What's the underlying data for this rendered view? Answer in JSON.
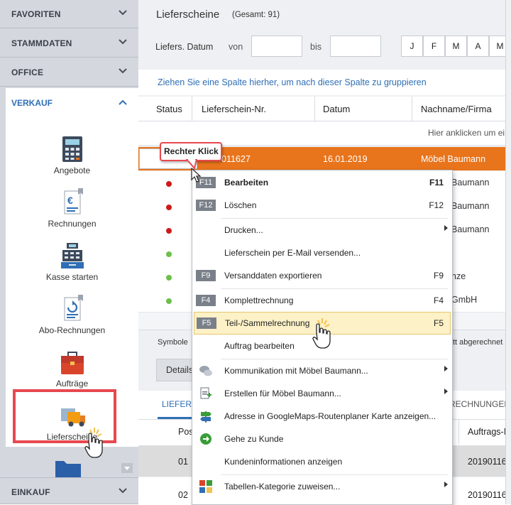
{
  "sidebar": {
    "sections": {
      "favoriten": "FAVORITEN",
      "stammdaten": "STAMMDATEN",
      "office": "OFFICE",
      "verkauf": "VERKAUF",
      "einkauf": "EINKAUF"
    },
    "items": [
      {
        "label": "Angebote",
        "icon": "calculator-icon"
      },
      {
        "label": "Rechnungen",
        "icon": "invoice-euro-icon"
      },
      {
        "label": "Kasse starten",
        "icon": "cash-register-icon"
      },
      {
        "label": "Abo-Rechnungen",
        "icon": "subscription-invoice-icon"
      },
      {
        "label": "Aufträge",
        "icon": "briefcase-icon"
      },
      {
        "label": "Lieferscheine",
        "icon": "delivery-truck-icon"
      }
    ]
  },
  "header": {
    "title": "Lieferscheine",
    "count": "(Gesamt: 91)",
    "date_label": "Liefers. Datum",
    "from_label": "von",
    "to_label": "bis",
    "month_buttons": [
      "J",
      "F",
      "M",
      "A",
      "M"
    ]
  },
  "group_hint": "Ziehen Sie eine Spalte hierher, um nach dieser Spalte zu gruppieren",
  "table": {
    "columns": [
      "Status",
      "Lieferschein-Nr.",
      "Datum",
      "Nachname/Firma"
    ],
    "filter_hint": "Hier anklicken um ei",
    "selected_row": {
      "number": "011627",
      "date": "16.01.2019",
      "name": "Möbel Baumann"
    },
    "rows": [
      {
        "status": "red",
        "name": "Baumann"
      },
      {
        "status": "red",
        "name": "Baumann"
      },
      {
        "status": "red",
        "name": "Baumann"
      },
      {
        "status": "green",
        "name": ""
      },
      {
        "status": "green",
        "name": "nze"
      },
      {
        "status": "green",
        "name": "GmbH"
      }
    ]
  },
  "legend": {
    "left": "Symbole",
    "right": "tt abgerechnet"
  },
  "details": {
    "button": "Details",
    "tab_left": "LIEFER",
    "tab_right": "RECHNUNGEN",
    "pos_header": "Pos",
    "auftrags_header": "Auftrags-N",
    "rows": [
      {
        "pos": "01",
        "auftrag": "20190116"
      },
      {
        "pos": "02",
        "auftrag": "20190116"
      }
    ]
  },
  "callout": {
    "text": "Rechter Klick"
  },
  "context_menu": {
    "items": [
      {
        "key": "F11",
        "label": "Bearbeiten",
        "shortcut": "F11",
        "bold": true
      },
      {
        "key": "F12",
        "label": "Löschen",
        "shortcut": "F12"
      },
      {
        "label": "Drucken...",
        "submenu": true
      },
      {
        "label": "Lieferschein per E-Mail versenden..."
      },
      {
        "key": "F9",
        "label": "Versanddaten exportieren",
        "shortcut": "F9"
      },
      {
        "key": "F4",
        "label": "Komplettrechnung",
        "shortcut": "F4"
      },
      {
        "key": "F5",
        "label": "Teil-/Sammelrechnung",
        "shortcut": "F5",
        "highlighted": true
      },
      {
        "label": "Auftrag bearbeiten"
      },
      {
        "label": "Kommunikation mit Möbel Baumann...",
        "icon": "chat-bubbles-icon",
        "submenu": true
      },
      {
        "label": "Erstellen für Möbel Baumann...",
        "icon": "create-document-icon",
        "submenu": true
      },
      {
        "label": "Adresse in GoogleMaps-Routenplaner Karte anzeigen...",
        "icon": "signpost-icon"
      },
      {
        "label": "Gehe zu Kunde",
        "icon": "go-arrow-icon"
      },
      {
        "label": "Kundeninformationen anzeigen"
      },
      {
        "label": "Tabellen-Kategorie zuweisen...",
        "icon": "color-grid-icon",
        "submenu": true
      }
    ]
  },
  "colors": {
    "accent_blue": "#2f6fb5",
    "selected_orange": "#e8741c",
    "highlight_box": "#e8484f",
    "menu_highlight": "#fdf1c7"
  }
}
